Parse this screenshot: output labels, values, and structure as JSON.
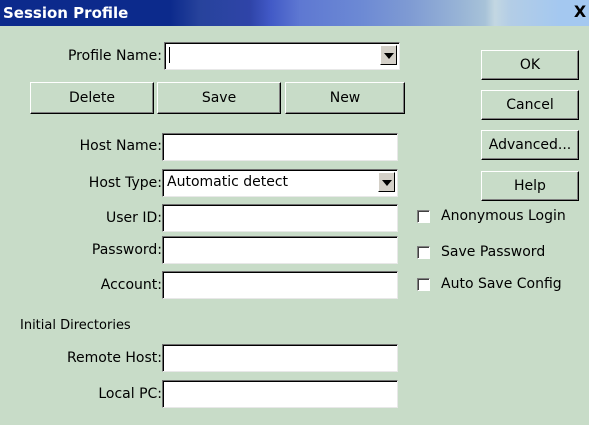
{
  "window": {
    "title": "Session Profile",
    "close_glyph": "X"
  },
  "profile": {
    "label": "Profile Name:",
    "value": ""
  },
  "buttons": {
    "delete": "Delete",
    "save": "Save",
    "new": "New"
  },
  "side_buttons": {
    "ok": "OK",
    "cancel": "Cancel",
    "advanced": "Advanced...",
    "help": "Help"
  },
  "host": {
    "name_label": "Host Name:",
    "name_value": "",
    "type_label": "Host Type:",
    "type_value": "Automatic detect"
  },
  "user": {
    "id_label": "User ID:",
    "id_value": ""
  },
  "password": {
    "label": "Password:",
    "value": ""
  },
  "account": {
    "label": "Account:",
    "value": ""
  },
  "checkboxes": {
    "anonymous": "Anonymous Login",
    "save_password": "Save Password",
    "auto_save": "Auto Save Config"
  },
  "initial_dirs": {
    "heading": "Initial Directories",
    "remote_label": "Remote Host:",
    "remote_value": "",
    "local_label": "Local PC:",
    "local_value": ""
  }
}
